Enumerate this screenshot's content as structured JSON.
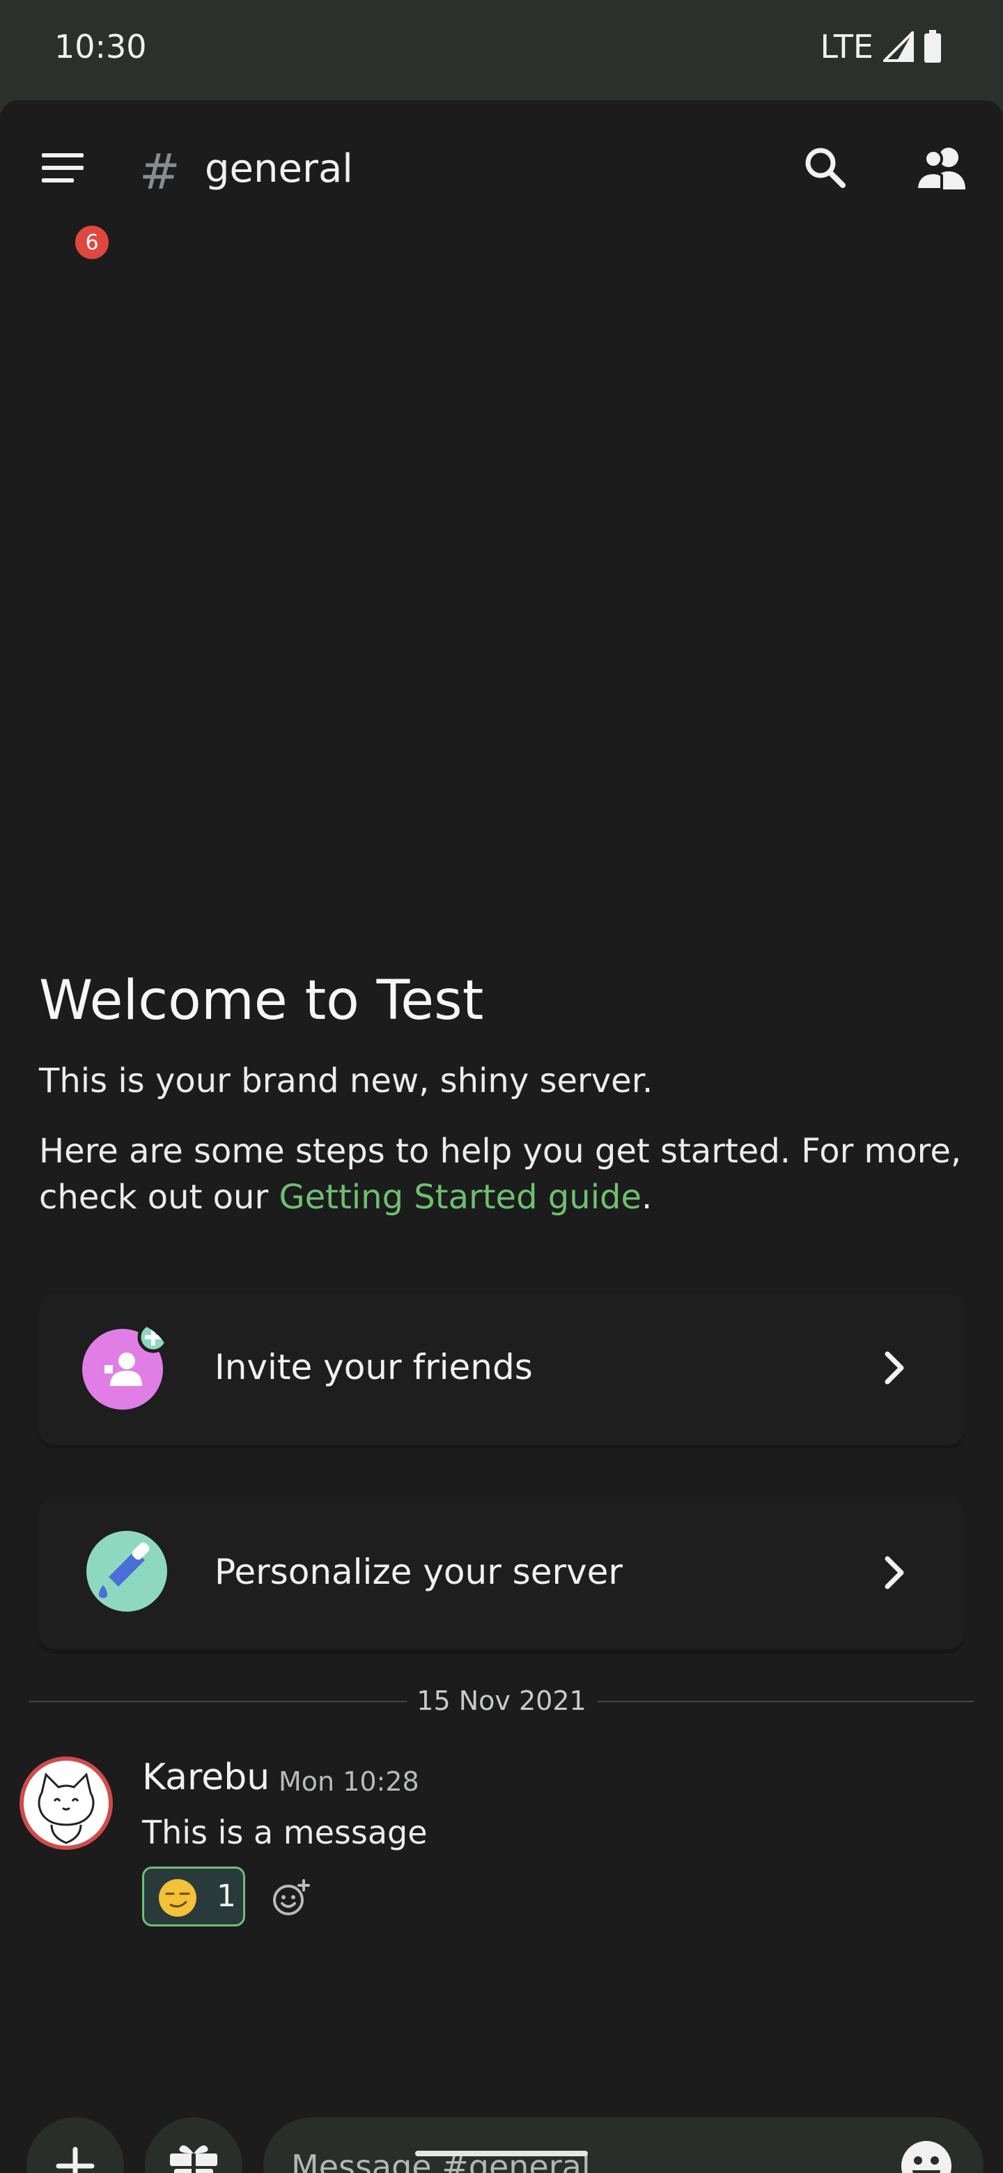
{
  "status_bar": {
    "time": "10:30",
    "network": "LTE"
  },
  "header": {
    "unread_count": "6",
    "channel_hash": "#",
    "channel_name": "general"
  },
  "welcome": {
    "title": "Welcome to Test",
    "subtitle": "This is your brand new, shiny server.",
    "body_prefix": "Here are some steps to help you get started. For more, check out our ",
    "link_text": "Getting Started guide",
    "body_suffix": "."
  },
  "cards": [
    {
      "label": "Invite your friends",
      "icon": "invite-friends-icon"
    },
    {
      "label": "Personalize your server",
      "icon": "personalize-brush-icon"
    }
  ],
  "divider_date": "15 Nov 2021",
  "message": {
    "author": "Karebu",
    "timestamp": "Mon 10:28",
    "text": "This is a message",
    "reaction": {
      "emoji": "smirk-emoji",
      "count": "1"
    }
  },
  "composer": {
    "placeholder": "Message #general"
  },
  "colors": {
    "accent_green": "#6fbf73",
    "badge_red": "#e0473f",
    "invite_pink": "#e07ee6",
    "personalize_teal": "#8fd8c0"
  }
}
